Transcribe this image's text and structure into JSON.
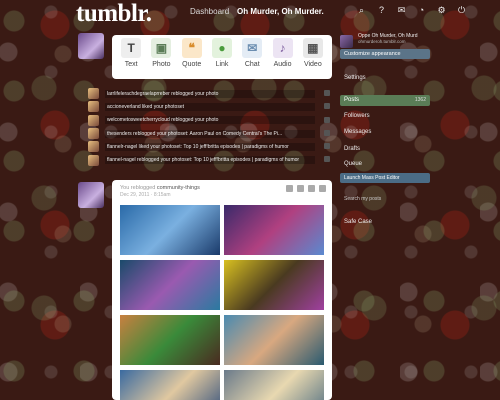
{
  "topbar": {
    "logo": "tumblr.",
    "dashboard_label": "Dashboard",
    "blog_label": "Oh Murder, Oh Murder.",
    "icons": [
      "search-icon",
      "help-icon",
      "mail-icon",
      "bell-icon",
      "gear-icon",
      "power-icon"
    ]
  },
  "postbar": {
    "items": [
      {
        "label": "Text",
        "glyph": "T",
        "color": "#444444",
        "bg": "#eeeeee"
      },
      {
        "label": "Photo",
        "glyph": "▣",
        "color": "#5a7c56",
        "bg": "#e5efe1"
      },
      {
        "label": "Quote",
        "glyph": "❝",
        "color": "#d88c2c",
        "bg": "#fbe7c9"
      },
      {
        "label": "Link",
        "glyph": "●",
        "color": "#4a9c3c",
        "bg": "#e3f2dd"
      },
      {
        "label": "Chat",
        "glyph": "✉",
        "color": "#6b8db0",
        "bg": "#e4ecf5"
      },
      {
        "label": "Audio",
        "glyph": "♪",
        "color": "#7a5a9c",
        "bg": "#ece4f3"
      },
      {
        "label": "Video",
        "glyph": "▦",
        "color": "#555555",
        "bg": "#e8e8e8"
      }
    ]
  },
  "activity": [
    "larrlifelerachdegraelaprreber reblogged your photo",
    "accioneverland liked your photoset",
    "welcometosweetcherrycloud reblogged your photo",
    "thesenders reblogged your photoset: Aaron Paul on Comedy Central's The Pi...",
    "flannelr-nagel liked your photoset: Top 10 jeff!britta episodes | paradigms of humor",
    "flannel-nagel reblogged your photoset: Top 10 jeff!britta episodes | paradigms of humor"
  ],
  "post": {
    "header_prefix": "You reblogged",
    "header_source": "community-things",
    "date": "Dec 29, 2011 · 8:15am"
  },
  "sidebar": {
    "blog_name": "Oppe Oh Murder, Oh Murd",
    "blog_url": "ohmurderoh.tumblr.com",
    "customize": "Customize appearance",
    "settings": "Settings",
    "posts_label": "Posts",
    "posts_count": "1362",
    "followers": "Followers",
    "messages": "Messages",
    "drafts": "Drafts",
    "queue": "Queue",
    "launch": "Launch Mass Post Editor",
    "search": "Search my posts",
    "safe_case": "Safe Case"
  }
}
